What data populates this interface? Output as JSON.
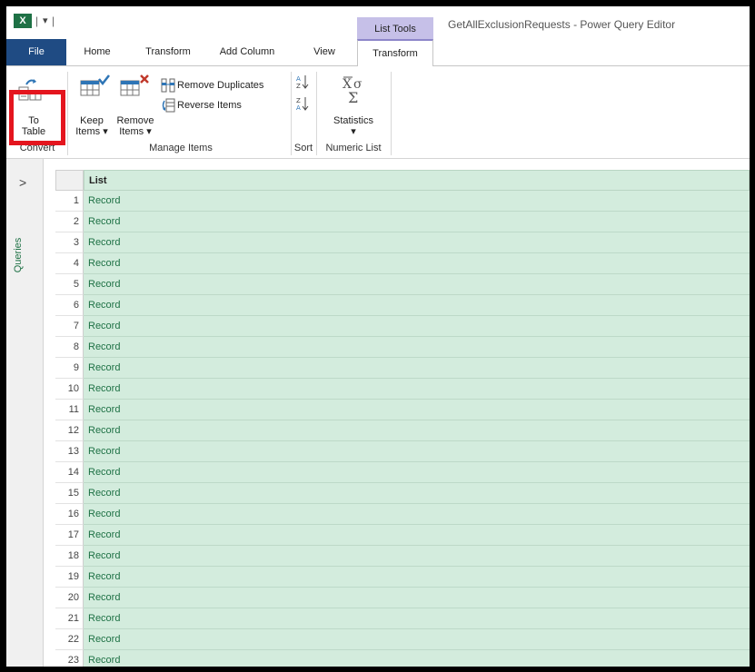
{
  "title_bar": {
    "quick_access": "X",
    "contextual_tab_group": "List Tools",
    "window_title": "GetAllExclusionRequests - Power Query Editor"
  },
  "tabs": [
    "File",
    "Home",
    "Transform",
    "Add Column",
    "View",
    "Transform"
  ],
  "ribbon": {
    "convert": {
      "to_table_line1": "To",
      "to_table_line2": "Table",
      "group_label": "Convert"
    },
    "manage_items": {
      "keep_line1": "Keep",
      "keep_line2": "Items ▾",
      "remove_line1": "Remove",
      "remove_line2": "Items ▾",
      "remove_duplicates": "Remove Duplicates",
      "reverse_items": "Reverse Items",
      "group_label": "Manage Items"
    },
    "sort": {
      "group_label": "Sort"
    },
    "numeric_list": {
      "statistics": "Statistics",
      "statistics_dd": "▾",
      "group_label": "Numeric List"
    }
  },
  "left_pane": {
    "chevron": ">",
    "label": "Queries"
  },
  "grid": {
    "column_header": "List",
    "rows": [
      {
        "n": "1",
        "v": "Record"
      },
      {
        "n": "2",
        "v": "Record"
      },
      {
        "n": "3",
        "v": "Record"
      },
      {
        "n": "4",
        "v": "Record"
      },
      {
        "n": "5",
        "v": "Record"
      },
      {
        "n": "6",
        "v": "Record"
      },
      {
        "n": "7",
        "v": "Record"
      },
      {
        "n": "8",
        "v": "Record"
      },
      {
        "n": "9",
        "v": "Record"
      },
      {
        "n": "10",
        "v": "Record"
      },
      {
        "n": "11",
        "v": "Record"
      },
      {
        "n": "12",
        "v": "Record"
      },
      {
        "n": "13",
        "v": "Record"
      },
      {
        "n": "14",
        "v": "Record"
      },
      {
        "n": "15",
        "v": "Record"
      },
      {
        "n": "16",
        "v": "Record"
      },
      {
        "n": "17",
        "v": "Record"
      },
      {
        "n": "18",
        "v": "Record"
      },
      {
        "n": "19",
        "v": "Record"
      },
      {
        "n": "20",
        "v": "Record"
      },
      {
        "n": "21",
        "v": "Record"
      },
      {
        "n": "22",
        "v": "Record"
      },
      {
        "n": "23",
        "v": "Record"
      }
    ]
  },
  "colors": {
    "accent_file_tab": "#1f4b83",
    "list_tools": "#c6c0e8",
    "cell_fill": "#d3ecdd",
    "highlight": "#e4151e"
  }
}
